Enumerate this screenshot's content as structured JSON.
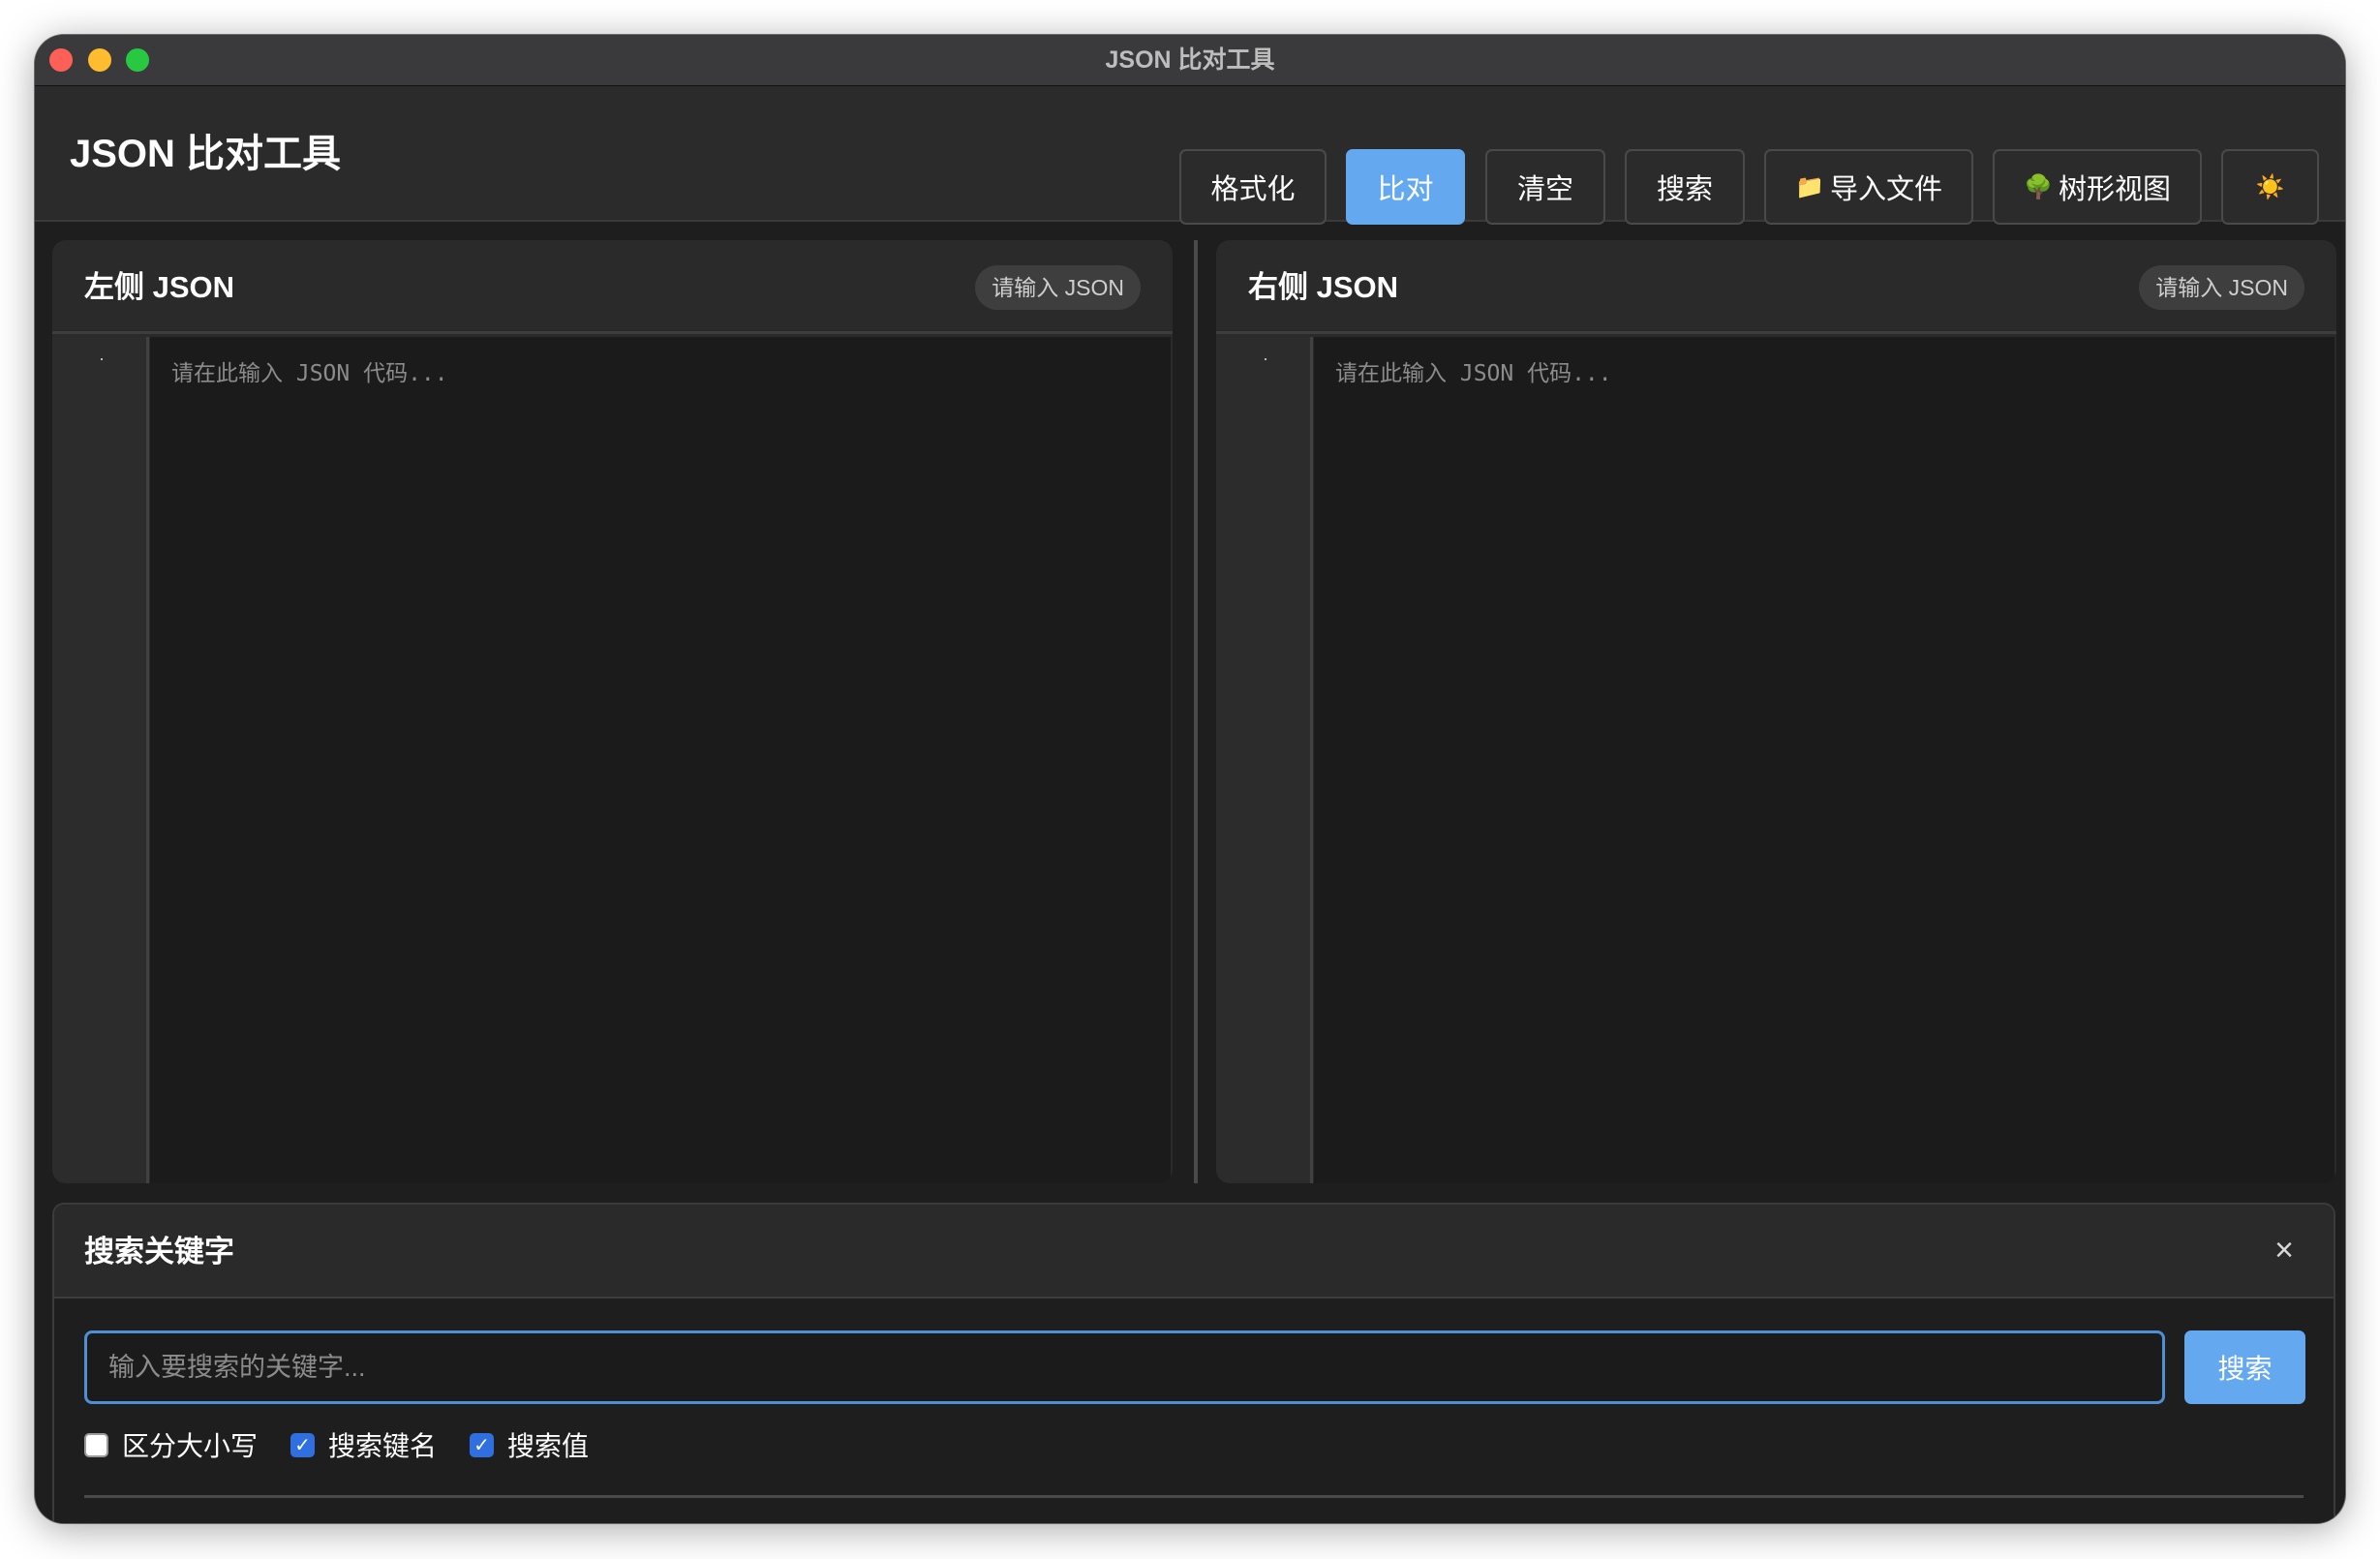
{
  "window": {
    "title": "JSON 比对工具"
  },
  "header": {
    "title": "JSON 比对工具",
    "buttons": {
      "format": "格式化",
      "compare": "比对",
      "clear": "清空",
      "search": "搜索",
      "import": "导入文件",
      "tree": "树形视图"
    },
    "icons": {
      "import": "📁",
      "tree": "🌳",
      "theme": "☀️"
    }
  },
  "left_panel": {
    "title": "左侧 JSON",
    "badge": "请输入 JSON",
    "placeholder": "请在此输入 JSON 代码...",
    "value": ""
  },
  "right_panel": {
    "title": "右侧 JSON",
    "badge": "请输入 JSON",
    "placeholder": "请在此输入 JSON 代码...",
    "value": ""
  },
  "search_panel": {
    "title": "搜索关键字",
    "close_icon": "×",
    "input_placeholder": "输入要搜索的关键字...",
    "input_value": "",
    "button": "搜索",
    "options": {
      "case_sensitive": {
        "label": "区分大小写",
        "checked": false
      },
      "search_keys": {
        "label": "搜索键名",
        "checked": true
      },
      "search_values": {
        "label": "搜索值",
        "checked": true
      }
    }
  },
  "colors": {
    "accent": "#64a9f0",
    "checkbox": "#2f6fe0",
    "background": "#1e1e1e",
    "panel": "#2a2a2a",
    "editor": "#1b1b1b"
  }
}
